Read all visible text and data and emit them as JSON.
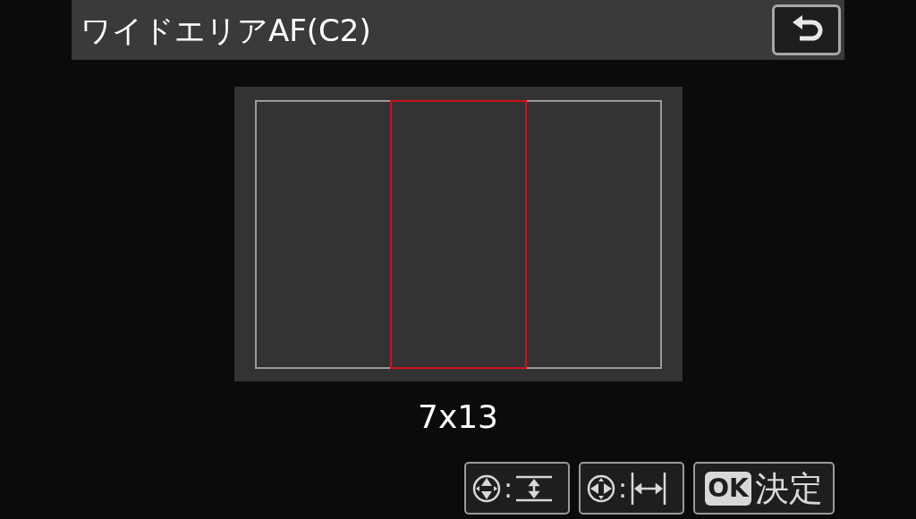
{
  "title": "ワイドエリアAF(C2)",
  "af_zones": [
    {
      "selected": false
    },
    {
      "selected": true
    },
    {
      "selected": false
    }
  ],
  "area_size": "7x13",
  "buttons": [
    {
      "kind": "vertical",
      "separator": ":"
    },
    {
      "kind": "horizontal",
      "separator": ":"
    },
    {
      "kind": "ok",
      "badge": "OK",
      "label": "決定"
    }
  ]
}
